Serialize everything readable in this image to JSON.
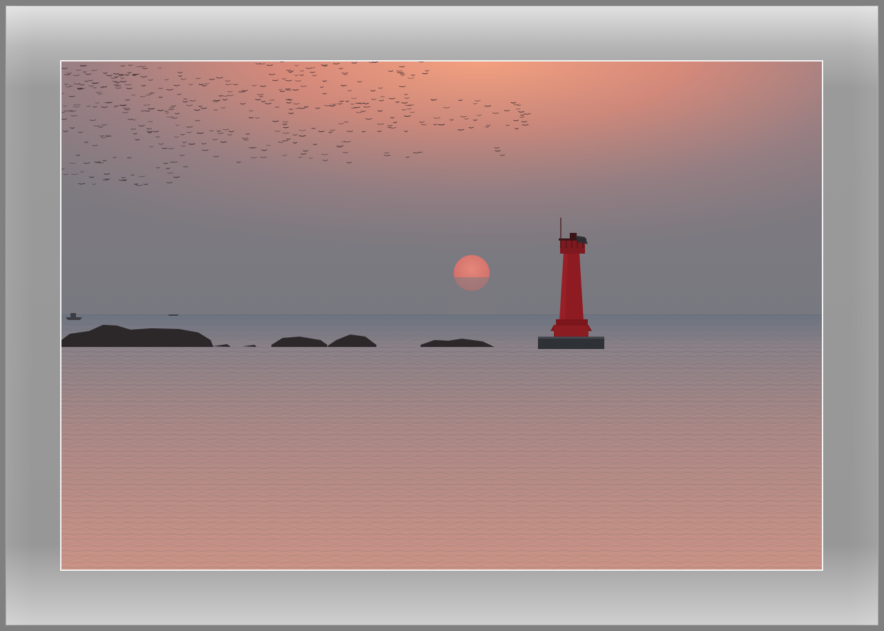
{
  "image": {
    "alt": "",
    "subjects": [
      "sky",
      "sun",
      "bird-flock",
      "lighthouse",
      "rocks",
      "boats",
      "sea"
    ]
  },
  "colors": {
    "frame_outer": "#808080",
    "mat_light": "#e2e2e2",
    "mat_mid": "#979797",
    "photo_border": "#f2f2f2",
    "sky_top": "#e8957a",
    "sky_mid": "#b48480",
    "sky_horizon": "#7c7a80",
    "sun": "#e8786e",
    "lighthouse": "#8a1a1f",
    "lighthouse_dark": "#3a1416",
    "rock": "#2e2a2c",
    "sea_far": "#6f7681",
    "sea_near": "#c58f86"
  }
}
